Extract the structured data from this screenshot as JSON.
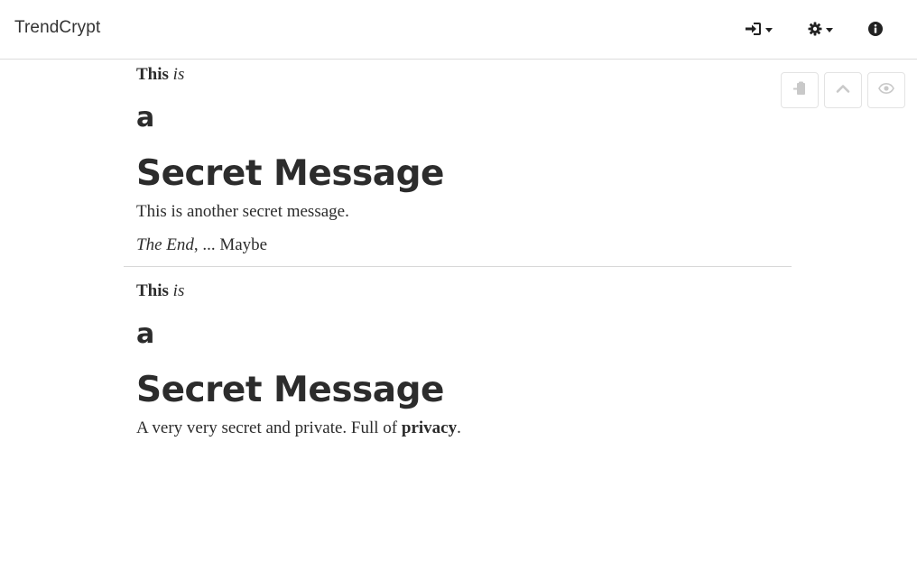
{
  "navbar": {
    "brand": "TrendCrypt",
    "icons": [
      "sign-in-icon",
      "gear-icon",
      "info-icon"
    ]
  },
  "toolbar": {
    "icons": [
      "paste-icon",
      "chevron-up-icon",
      "eye-icon"
    ]
  },
  "messages": [
    {
      "line1_bold": "This",
      "line1_italic": "is",
      "heading_small": "a",
      "heading_large": "Secret Message",
      "paragraph1": "This is another secret message.",
      "paragraph2_italic": "The End",
      "paragraph2_rest": ", ... Maybe"
    },
    {
      "line1_bold": "This",
      "line1_italic": "is",
      "heading_small": "a",
      "heading_large": "Secret Message",
      "paragraph1_start": "A very very secret and private. Full of ",
      "paragraph1_bold": "privacy",
      "paragraph1_end": "."
    }
  ]
}
